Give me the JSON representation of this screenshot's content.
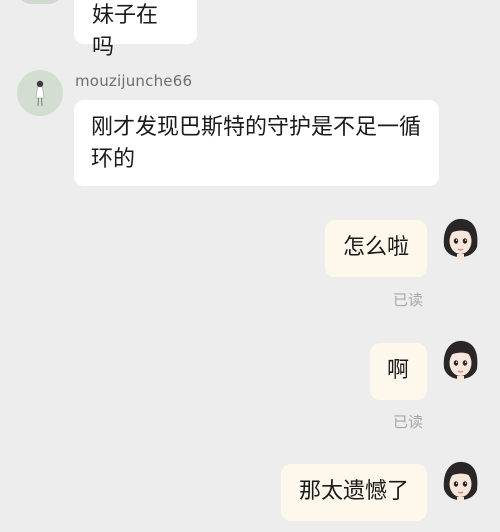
{
  "messages": [
    {
      "side": "in",
      "text": "妹子在吗"
    },
    {
      "side": "in",
      "sender": "mouzijunche66",
      "text": "刚才发现巴斯特的守护是不足一循环的"
    },
    {
      "side": "out",
      "text": "怎么啦",
      "status": "已读"
    },
    {
      "side": "out",
      "text": "啊",
      "status": "已读"
    },
    {
      "side": "out",
      "text": "那太遗憾了"
    }
  ],
  "avatars": {
    "incoming": "girl-silhouette-avatar",
    "outgoing": "cartoon-girl-avatar"
  },
  "colors": {
    "background": "#ededed",
    "incoming_bubble": "#ffffff",
    "outgoing_bubble": "#fdf7ec",
    "read_status": "#a8a8a8"
  }
}
